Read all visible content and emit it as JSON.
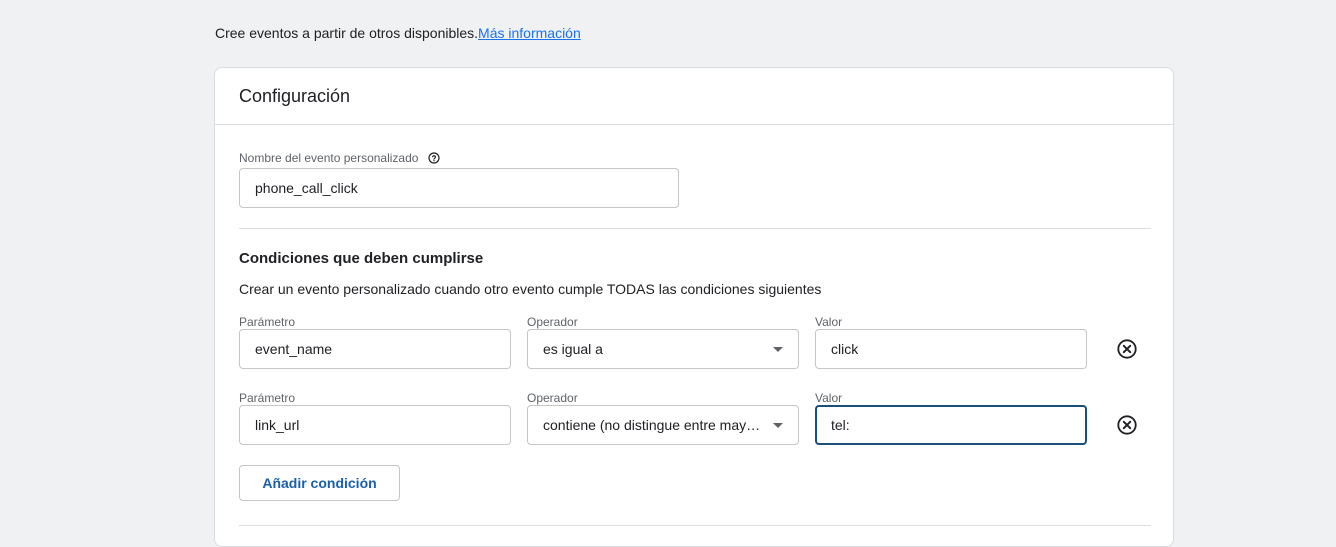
{
  "intro": {
    "text": "Cree eventos a partir de otros disponibles.",
    "link": "Más información"
  },
  "card": {
    "title": "Configuración",
    "event_name": {
      "label": "Nombre del evento personalizado",
      "value": "phone_call_click",
      "help_icon": "help-circle-icon"
    },
    "conditions": {
      "title": "Condiciones que deben cumplirse",
      "description": "Crear un evento personalizado cuando otro evento cumple TODAS las condiciones siguientes",
      "rows": [
        {
          "param_label": "Parámetro",
          "param_value": "event_name",
          "op_label": "Operador",
          "op_value": "es igual a",
          "value_label": "Valor",
          "value_value": "click"
        },
        {
          "param_label": "Parámetro",
          "param_value": "link_url",
          "op_label": "Operador",
          "op_value": "contiene (no distingue entre mayúsculas y minúsculas)",
          "value_label": "Valor",
          "value_value": "tel:"
        }
      ],
      "add_button": "Añadir condición"
    }
  },
  "colors": {
    "link": "#1a73e8",
    "focus_border": "#1a4f7a",
    "button_text": "#1a5fa8",
    "background": "#f0f1f3"
  }
}
